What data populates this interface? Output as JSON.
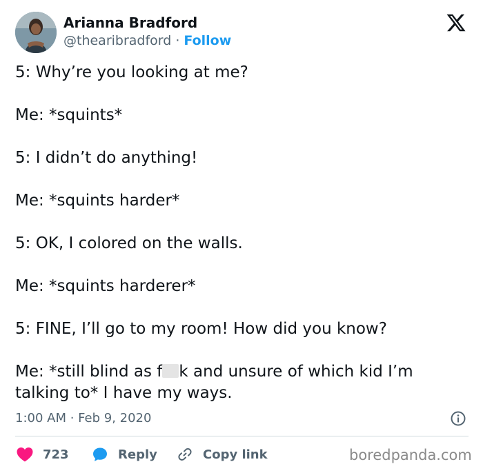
{
  "author": {
    "name": "Arianna Bradford",
    "handle": "@thearibradford",
    "separator": "·",
    "follow_label": "Follow"
  },
  "platform_icon": "x-logo-icon",
  "tweet": {
    "lines": [
      "5: Why’re you looking at me?",
      "Me: *squints*",
      "5: I didn’t do anything!",
      "Me: *squints harder*",
      "5: OK, I colored on the walls.",
      "Me: *squints harderer*",
      "5: FINE, I’ll go to my room! How did you know?"
    ],
    "last_line_part1": "Me: *still blind as f",
    "last_line_part2": "k and unsure of which kid I’m talking to* I have my ways."
  },
  "timestamp": "1:00 AM · Feb 9, 2020",
  "actions": {
    "like_count": "723",
    "reply_label": "Reply",
    "copy_link_label": "Copy link"
  },
  "watermark": "boredpanda.com",
  "colors": {
    "accent": "#1d9bf0",
    "like": "#f91880",
    "text": "#0f1419",
    "muted": "#536471"
  }
}
